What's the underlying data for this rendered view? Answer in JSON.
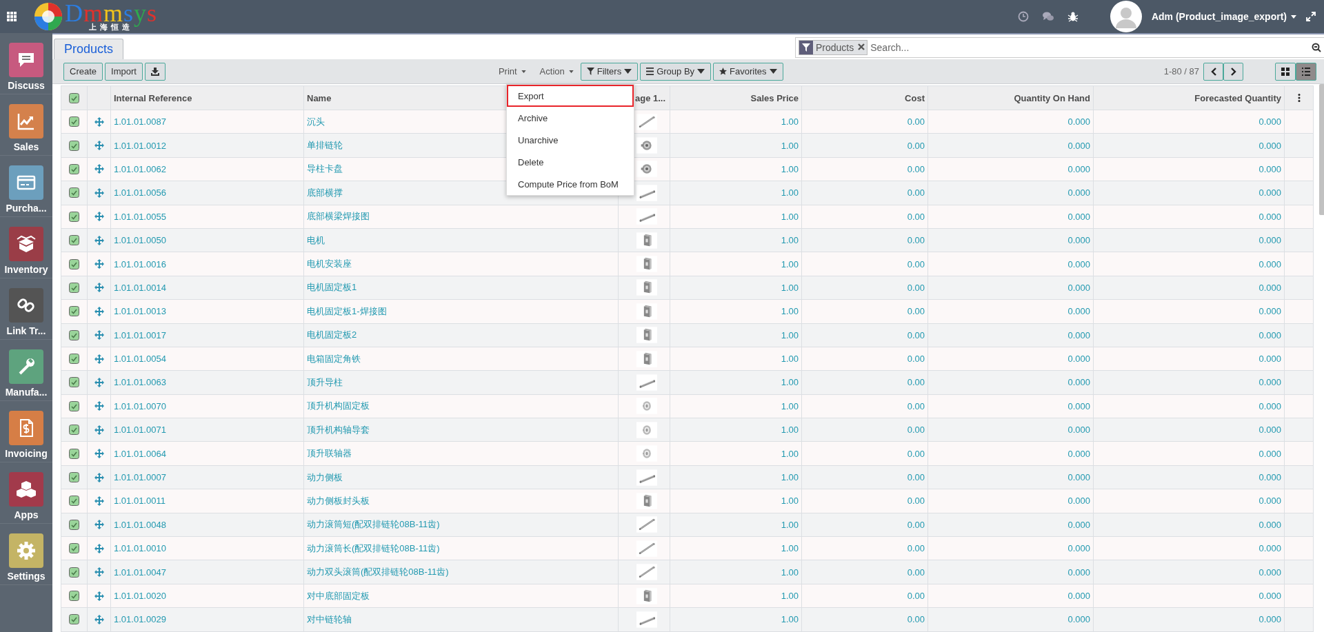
{
  "topbar": {
    "logo_text": "Dmmsys",
    "logo_subtitle": "上海恒造",
    "user": "Adm (Product_image_export)"
  },
  "sidebar": {
    "items": [
      {
        "label": "Discuss",
        "color": "#c75a7f"
      },
      {
        "label": "Sales",
        "color": "#d4814c"
      },
      {
        "label": "Purcha...",
        "color": "#6c9fbd"
      },
      {
        "label": "Inventory",
        "color": "#9a3d47"
      },
      {
        "label": "Link Tr...",
        "color": "#545454"
      },
      {
        "label": "Manufa...",
        "color": "#5ea37e"
      },
      {
        "label": "Invoicing",
        "color": "#d67e46"
      },
      {
        "label": "Apps",
        "color": "#a23a4b"
      },
      {
        "label": "Settings",
        "color": "#c4b465"
      }
    ]
  },
  "breadcrumb": "Products",
  "search": {
    "facet": "Products",
    "placeholder": "Search..."
  },
  "buttons": [
    "Create",
    "Import"
  ],
  "menus": [
    "Print",
    "Action"
  ],
  "search_options": [
    "Filters",
    "Group By",
    "Favorites"
  ],
  "pager": "1-80 / 87",
  "views": [
    {
      "kind": "kanban",
      "selected": false
    },
    {
      "kind": "list",
      "selected": true
    }
  ],
  "table": {
    "all_selected": true,
    "columns": [
      "Internal Reference",
      "Name",
      "age 1...",
      "Sales Price",
      "Cost",
      "Quantity On Hand",
      "Forecasted Quantity"
    ],
    "rows": [
      {
        "selected": true,
        "ref": "1.01.01.0087",
        "name": "沉头",
        "price": "1.00",
        "cost": "0.00",
        "on_hand": "0.000",
        "forecast": "0.000"
      },
      {
        "selected": true,
        "ref": "1.01.01.0012",
        "name": "单排链轮",
        "price": "1.00",
        "cost": "0.00",
        "on_hand": "0.000",
        "forecast": "0.000"
      },
      {
        "selected": true,
        "ref": "1.01.01.0062",
        "name": "导柱卡盘",
        "price": "1.00",
        "cost": "0.00",
        "on_hand": "0.000",
        "forecast": "0.000"
      },
      {
        "selected": true,
        "ref": "1.01.01.0056",
        "name": "底部横撑",
        "price": "1.00",
        "cost": "0.00",
        "on_hand": "0.000",
        "forecast": "0.000"
      },
      {
        "selected": true,
        "ref": "1.01.01.0055",
        "name": "底部横梁焊接图",
        "price": "1.00",
        "cost": "0.00",
        "on_hand": "0.000",
        "forecast": "0.000"
      },
      {
        "selected": true,
        "ref": "1.01.01.0050",
        "name": "电机",
        "price": "1.00",
        "cost": "0.00",
        "on_hand": "0.000",
        "forecast": "0.000"
      },
      {
        "selected": true,
        "ref": "1.01.01.0016",
        "name": "电机安装座",
        "price": "1.00",
        "cost": "0.00",
        "on_hand": "0.000",
        "forecast": "0.000"
      },
      {
        "selected": true,
        "ref": "1.01.01.0014",
        "name": "电机固定板1",
        "price": "1.00",
        "cost": "0.00",
        "on_hand": "0.000",
        "forecast": "0.000"
      },
      {
        "selected": true,
        "ref": "1.01.01.0013",
        "name": "电机固定板1-焊接图",
        "price": "1.00",
        "cost": "0.00",
        "on_hand": "0.000",
        "forecast": "0.000"
      },
      {
        "selected": true,
        "ref": "1.01.01.0017",
        "name": "电机固定板2",
        "price": "1.00",
        "cost": "0.00",
        "on_hand": "0.000",
        "forecast": "0.000"
      },
      {
        "selected": true,
        "ref": "1.01.01.0054",
        "name": "电箱固定角铁",
        "price": "1.00",
        "cost": "0.00",
        "on_hand": "0.000",
        "forecast": "0.000"
      },
      {
        "selected": true,
        "ref": "1.01.01.0063",
        "name": "顶升导柱",
        "price": "1.00",
        "cost": "0.00",
        "on_hand": "0.000",
        "forecast": "0.000"
      },
      {
        "selected": true,
        "ref": "1.01.01.0070",
        "name": "顶升机构固定板",
        "price": "1.00",
        "cost": "0.00",
        "on_hand": "0.000",
        "forecast": "0.000"
      },
      {
        "selected": true,
        "ref": "1.01.01.0071",
        "name": "顶升机构轴导套",
        "price": "1.00",
        "cost": "0.00",
        "on_hand": "0.000",
        "forecast": "0.000"
      },
      {
        "selected": true,
        "ref": "1.01.01.0064",
        "name": "顶升联轴器",
        "price": "1.00",
        "cost": "0.00",
        "on_hand": "0.000",
        "forecast": "0.000"
      },
      {
        "selected": true,
        "ref": "1.01.01.0007",
        "name": "动力侧板",
        "price": "1.00",
        "cost": "0.00",
        "on_hand": "0.000",
        "forecast": "0.000"
      },
      {
        "selected": true,
        "ref": "1.01.01.0011",
        "name": "动力侧板封头板",
        "price": "1.00",
        "cost": "0.00",
        "on_hand": "0.000",
        "forecast": "0.000"
      },
      {
        "selected": true,
        "ref": "1.01.01.0048",
        "name": "动力滚筒短(配双排链轮08B-11齿)",
        "price": "1.00",
        "cost": "0.00",
        "on_hand": "0.000",
        "forecast": "0.000"
      },
      {
        "selected": true,
        "ref": "1.01.01.0010",
        "name": "动力滚筒长(配双排链轮08B-11齿)",
        "price": "1.00",
        "cost": "0.00",
        "on_hand": "0.000",
        "forecast": "0.000"
      },
      {
        "selected": true,
        "ref": "1.01.01.0047",
        "name": "动力双头滚筒(配双排链轮08B-11齿)",
        "price": "1.00",
        "cost": "0.00",
        "on_hand": "0.000",
        "forecast": "0.000"
      },
      {
        "selected": true,
        "ref": "1.01.01.0020",
        "name": "对中底部固定板",
        "price": "1.00",
        "cost": "0.00",
        "on_hand": "0.000",
        "forecast": "0.000"
      },
      {
        "selected": true,
        "ref": "1.01.01.0029",
        "name": "对中链轮轴",
        "price": "1.00",
        "cost": "0.00",
        "on_hand": "0.000",
        "forecast": "0.000"
      }
    ]
  },
  "action_menu": {
    "items": [
      {
        "label": "Export",
        "selected": true
      },
      {
        "label": "Archive",
        "selected": false
      },
      {
        "label": "Unarchive",
        "selected": false
      },
      {
        "label": "Delete",
        "selected": false
      },
      {
        "label": "Compute Price from BoM",
        "selected": false
      }
    ]
  }
}
